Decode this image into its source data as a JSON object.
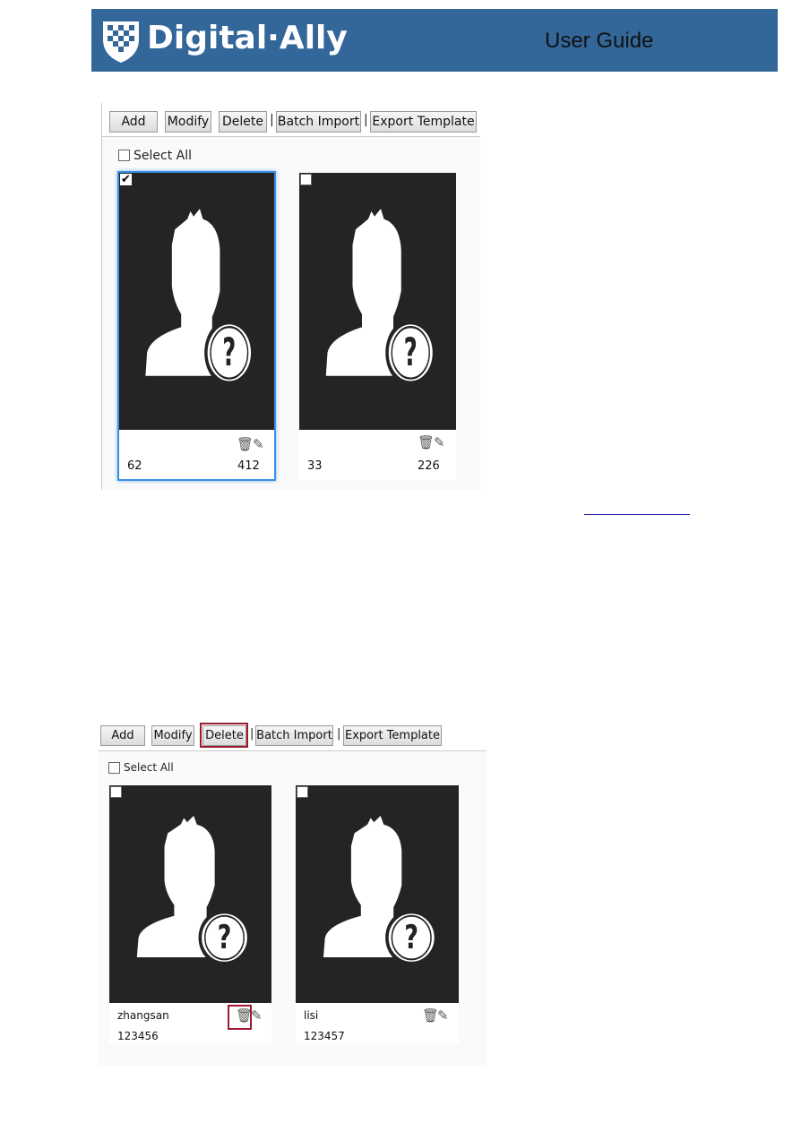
{
  "header": {
    "brand": "Digital·Ally",
    "title": "User Guide",
    "color": "#336699"
  },
  "screenshot1": {
    "toolbar": {
      "add": "Add",
      "modify": "Modify",
      "delete": "Delete",
      "separator": "|",
      "batch_import": "Batch Import",
      "export_template": "Export Template"
    },
    "select_all": "Select All",
    "cards": [
      {
        "checked": true,
        "selected": true,
        "name": "",
        "id_left": "62",
        "id_right": "412"
      },
      {
        "checked": false,
        "selected": false,
        "name": "",
        "id_left": "33",
        "id_right": "226"
      }
    ]
  },
  "screenshot2": {
    "toolbar": {
      "add": "Add",
      "modify": "Modify",
      "delete": "Delete",
      "separator": "|",
      "batch_import": "Batch Import",
      "export_template": "Export Template"
    },
    "select_all": "Select All",
    "highlight_color": "#9b1b30",
    "cards": [
      {
        "checked": false,
        "name": "zhangsan",
        "id": "123456"
      },
      {
        "checked": false,
        "name": "lisi",
        "id": "123457"
      }
    ]
  },
  "icons": {
    "trash": "trash-icon",
    "pencil": "pencil-icon",
    "avatar": "unknown-person-icon"
  }
}
